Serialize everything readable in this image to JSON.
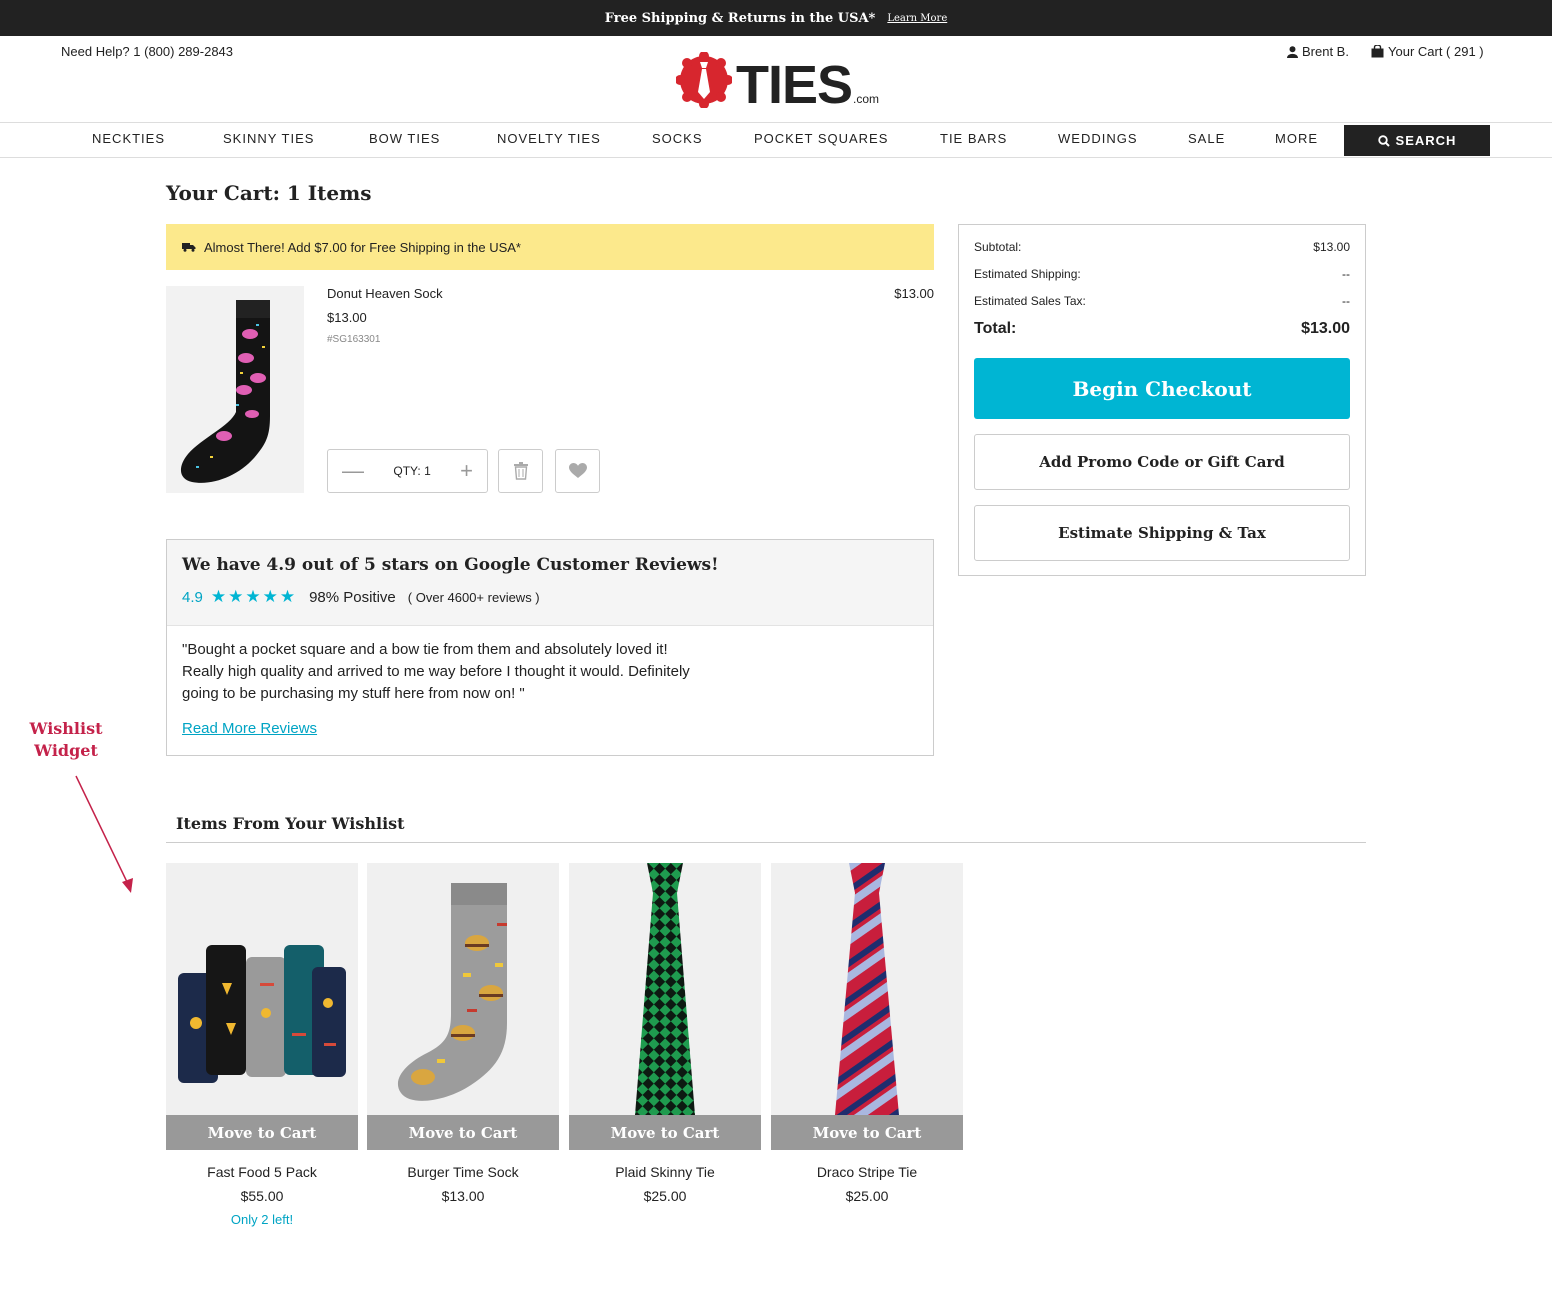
{
  "topbar": {
    "message": "Free Shipping & Returns in the USA*",
    "link": "Learn More"
  },
  "header": {
    "help": "Need Help? 1 (800) 289-2843",
    "logo_word": "TIES",
    "logo_suffix": ".com",
    "user": "Brent B.",
    "cart": "Your Cart ( 291 )"
  },
  "nav": {
    "items": [
      "NECKTIES",
      "SKINNY TIES",
      "BOW TIES",
      "NOVELTY TIES",
      "SOCKS",
      "POCKET SQUARES",
      "TIE BARS",
      "WEDDINGS",
      "SALE",
      "MORE"
    ],
    "search": "SEARCH"
  },
  "cart": {
    "title": "Your Cart: 1 Items",
    "shipping_banner": "Almost There! Add $7.00 for Free Shipping in the USA*",
    "item": {
      "name": "Donut Heaven Sock",
      "price": "$13.00",
      "sku": "#SG163301",
      "line_total": "$13.00",
      "qty_label": "QTY: 1"
    }
  },
  "summary": {
    "subtotal_label": "Subtotal:",
    "subtotal": "$13.00",
    "shipping_label": "Estimated Shipping:",
    "shipping": "--",
    "tax_label": "Estimated Sales Tax:",
    "tax": "--",
    "total_label": "Total:",
    "total": "$13.00",
    "checkout": "Begin Checkout",
    "promo": "Add Promo Code or Gift Card",
    "estimate": "Estimate Shipping & Tax"
  },
  "reviews": {
    "title": "We have 4.9 out of 5 stars on Google Customer Reviews!",
    "score": "4.9",
    "stars": "★★★★★",
    "positive": "98% Positive",
    "count": "( Over 4600+ reviews )",
    "quote_lines": [
      "\"Bought a pocket square and a bow tie from them and absolutely loved it!",
      "Really high quality and arrived to me way before I thought it would. Definitely",
      "going to be purchasing my stuff here from now on! \""
    ],
    "read_more": "Read More Reviews"
  },
  "annotation": {
    "line1": "Wishlist",
    "line2": "Widget"
  },
  "wishlist": {
    "title": "Items From Your Wishlist",
    "move_label": "Move to Cart",
    "items": [
      {
        "name": "Fast Food 5 Pack",
        "price": "$55.00",
        "stock": "Only 2 left!"
      },
      {
        "name": "Burger Time Sock",
        "price": "$13.00",
        "stock": ""
      },
      {
        "name": "Plaid Skinny Tie",
        "price": "$25.00",
        "stock": ""
      },
      {
        "name": "Draco Stripe Tie",
        "price": "$25.00",
        "stock": ""
      }
    ]
  },
  "colors": {
    "accent": "#00b5d3",
    "banner": "#fce98c",
    "logo_red": "#d7262e",
    "annotation": "#c4224a"
  }
}
